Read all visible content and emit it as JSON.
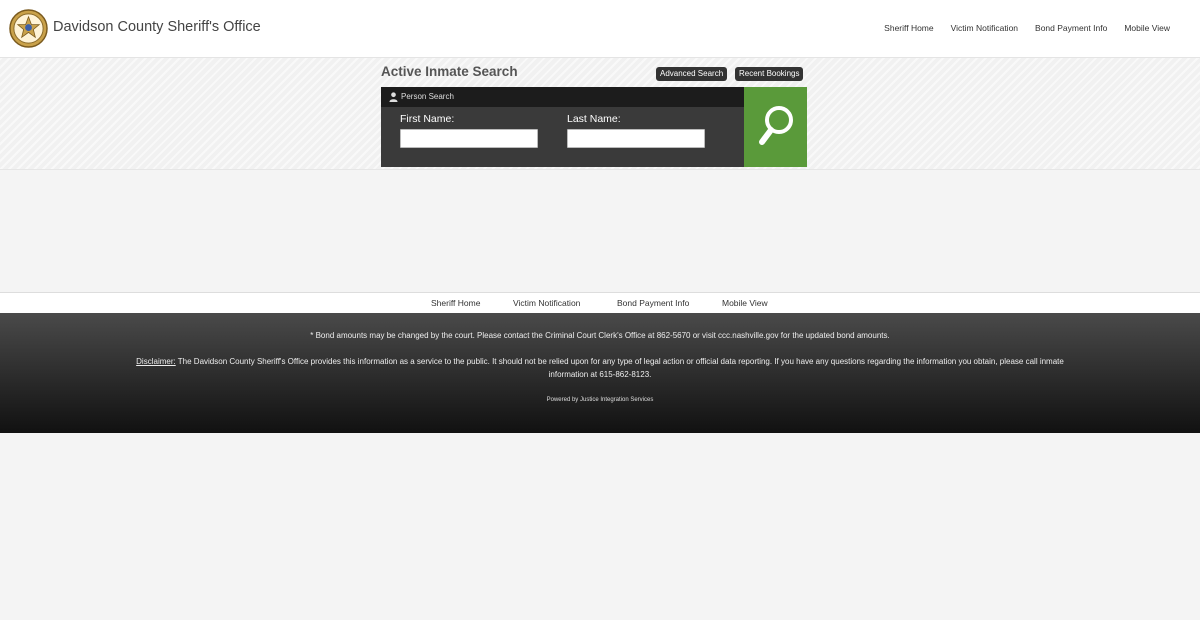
{
  "header": {
    "title": "Davidson County Sheriff's Office",
    "nav": [
      "Sheriff Home",
      "Victim Notification",
      "Bond Payment Info",
      "Mobile View"
    ]
  },
  "search": {
    "title": "Active Inmate Search",
    "advanced_label": "Advanced Search",
    "recent_label": "Recent Bookings",
    "panel_label": "Person Search",
    "first_name_label": "First Name:",
    "last_name_label": "Last Name:",
    "first_name_value": "",
    "last_name_value": ""
  },
  "bottom_nav": [
    "Sheriff Home",
    "Victim Notification",
    "Bond Payment Info",
    "Mobile View"
  ],
  "footer": {
    "bond_note": "* Bond amounts may be changed by the court. Please contact the Criminal Court Clerk's Office at 862-5670 or visit ccc.nashville.gov for the updated bond amounts.",
    "disclaimer_label": "Disclaimer:",
    "disclaimer_text": " The Davidson County Sheriff's Office provides this information as a service to the public. It should not be relied upon for any type of legal action or official data reporting. If you have any questions regarding the information you obtain, please call inmate information at 615-862-8123.",
    "powered": "Powered by Justice Integration Services"
  },
  "colors": {
    "search_button": "#5a9a3a",
    "panel_bg": "#3a3a3a",
    "panel_header": "#1c1c1c",
    "footer_top": "#4a4a4a",
    "footer_bottom": "#111111"
  },
  "icons": {
    "logo": "sheriff-badge-icon",
    "person": "person-icon",
    "search": "magnifier-icon"
  }
}
